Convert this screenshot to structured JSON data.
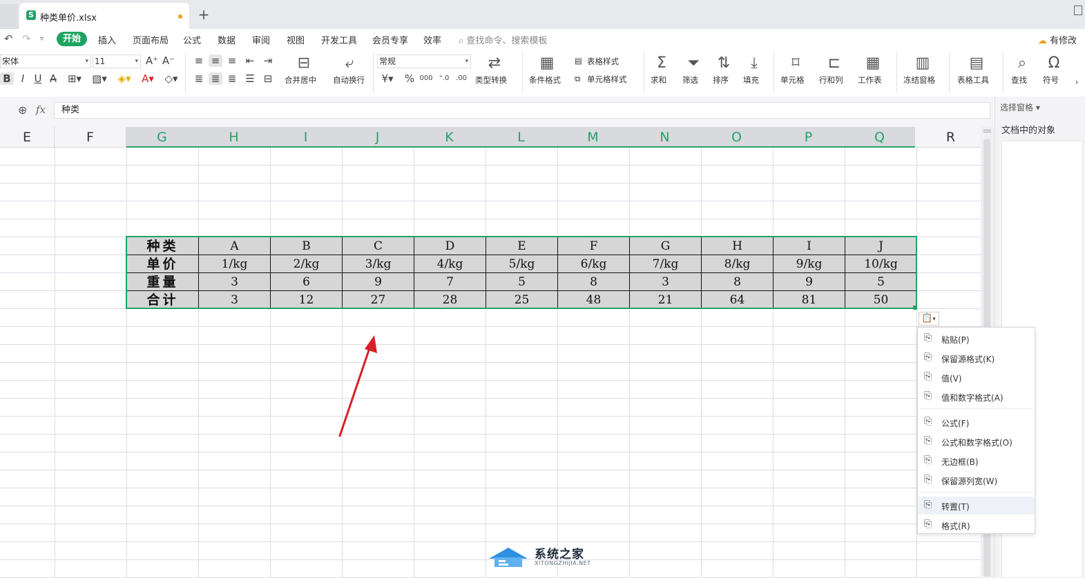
{
  "tab_bar": {
    "file_title": "种类单价.xlsx",
    "new_tab": "+"
  },
  "menu": {
    "active": "开始",
    "items": [
      "插入",
      "页面布局",
      "公式",
      "数据",
      "审阅",
      "视图",
      "开发工具",
      "会员专享",
      "效率"
    ],
    "search_placeholder": "查找命令、搜索模板",
    "modify": "有修改"
  },
  "ribbon": {
    "font_name": "宋体",
    "font_size": "11",
    "number_format": "常规",
    "merge_center": "合并居中",
    "auto_wrap": "自动换行",
    "type_convert": "类型转换",
    "conditional_format": "条件格式",
    "table_style": "表格样式",
    "cell_style": "单元格样式",
    "sum": "求和",
    "filter": "筛选",
    "sort": "排序",
    "fill": "填充",
    "cells": "单元格",
    "rows_cols": "行和列",
    "worksheet": "工作表",
    "freeze": "冻结窗格",
    "table_tools": "表格工具",
    "find": "查找",
    "symbol": "符号"
  },
  "formula_bar": {
    "value": "种类"
  },
  "side_pane": {
    "title": "选择窗格",
    "objects_label": "文档中的对象"
  },
  "columns": [
    "E",
    "F",
    "G",
    "H",
    "I",
    "J",
    "K",
    "L",
    "M",
    "N",
    "O",
    "P",
    "Q",
    "R"
  ],
  "table": {
    "rows": [
      {
        "header": "种类",
        "values": [
          "A",
          "B",
          "C",
          "D",
          "E",
          "F",
          "G",
          "H",
          "I",
          "J"
        ]
      },
      {
        "header": "单价",
        "values": [
          "1/kg",
          "2/kg",
          "3/kg",
          "4/kg",
          "5/kg",
          "6/kg",
          "7/kg",
          "8/kg",
          "9/kg",
          "10/kg"
        ]
      },
      {
        "header": "重量",
        "values": [
          "3",
          "6",
          "9",
          "7",
          "5",
          "8",
          "3",
          "8",
          "9",
          "5"
        ]
      },
      {
        "header": "合计",
        "values": [
          "3",
          "12",
          "27",
          "28",
          "25",
          "48",
          "21",
          "64",
          "81",
          "50"
        ]
      }
    ]
  },
  "paste_menu": {
    "items": [
      "粘贴(P)",
      "保留源格式(K)",
      "值(V)",
      "值和数字格式(A)",
      "公式(F)",
      "公式和数字格式(O)",
      "无边框(B)",
      "保留源列宽(W)",
      "转置(T)",
      "格式(R)"
    ]
  },
  "colors": {
    "accent_green": "#21a366",
    "selection_fill": "#d6d6d6",
    "arrow_red": "#d61f26"
  },
  "watermark": {
    "name": "系统之家",
    "url": "XITONGZHIJIA.NET"
  }
}
